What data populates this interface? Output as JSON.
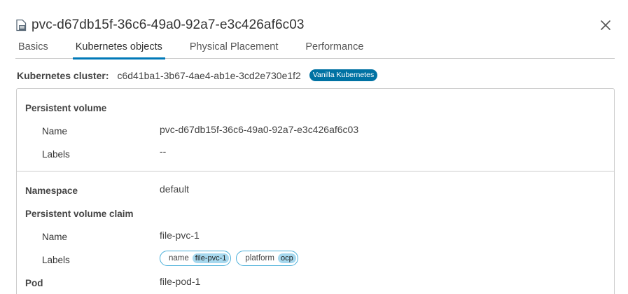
{
  "header": {
    "title": "pvc-d67db15f-36c6-49a0-92a7-e3c426af6c03",
    "icon": "volume-file-icon",
    "close_icon": "close-icon"
  },
  "tabs": [
    {
      "label": "Basics",
      "active": false
    },
    {
      "label": "Kubernetes objects",
      "active": true
    },
    {
      "label": "Physical Placement",
      "active": false
    },
    {
      "label": "Performance",
      "active": false
    }
  ],
  "cluster": {
    "label": "Kubernetes cluster:",
    "value": "c6d41ba1-3b67-4ae4-ab1e-3cd2e730e1f2",
    "badge": "Vanilla Kubernetes"
  },
  "persistent_volume": {
    "heading": "Persistent volume",
    "name_label": "Name",
    "name_value": "pvc-d67db15f-36c6-49a0-92a7-e3c426af6c03",
    "labels_label": "Labels",
    "labels_value": "--"
  },
  "namespace": {
    "label": "Namespace",
    "value": "default"
  },
  "pvc": {
    "heading": "Persistent volume claim",
    "name_label": "Name",
    "name_value": "file-pvc-1",
    "labels_label": "Labels",
    "labels": [
      {
        "key": "name",
        "value": "file-pvc-1"
      },
      {
        "key": "platform",
        "value": "ocp"
      }
    ]
  },
  "pod": {
    "label": "Pod",
    "value": "file-pod-1"
  },
  "colors": {
    "accent": "#0079b8",
    "badge": "#0072a3",
    "chip_border": "#49afd9",
    "chip_value_bg": "#a6d8ee"
  }
}
